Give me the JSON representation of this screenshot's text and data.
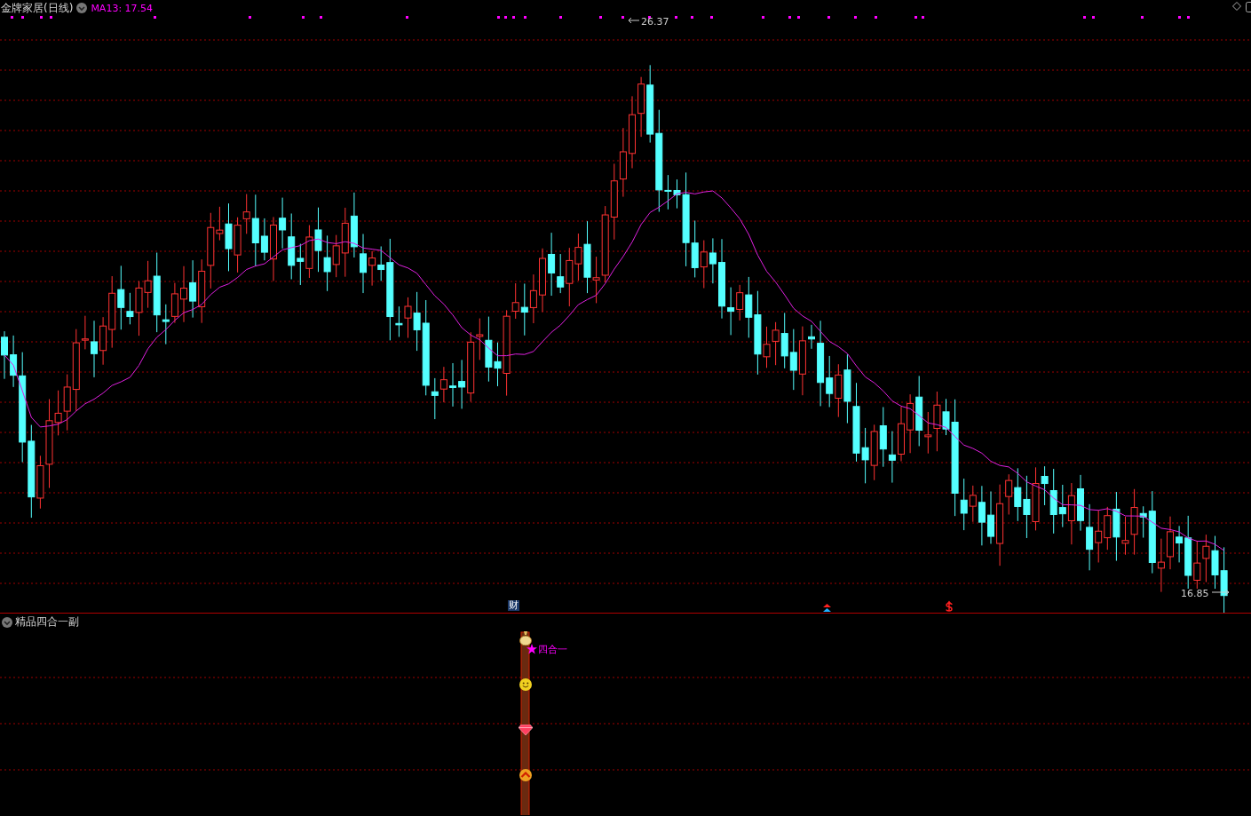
{
  "header": {
    "title": "金牌家居(日线)",
    "indicator": "MA13: 17.54"
  },
  "main_chart": {
    "high_label": "26.37",
    "low_label": "16.85",
    "event_badge": "财"
  },
  "sub_panel": {
    "title": "精品四合一副",
    "signal_label": "四合一"
  }
}
